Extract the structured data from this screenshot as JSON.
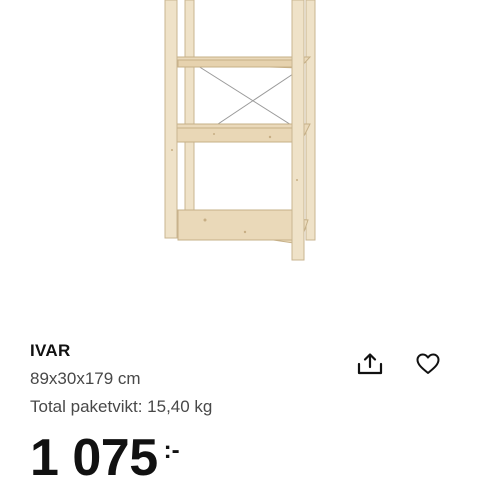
{
  "product": {
    "name": "IVAR",
    "dimensions": "89x30x179 cm",
    "package_weight": "Total paketvikt: 15,40 kg",
    "image_alt": "IVAR shelving unit, untreated pine"
  },
  "price": {
    "amount": "1 075",
    "suffix": ":-"
  },
  "actions": {
    "share_icon": "share-icon",
    "favorite_icon": "heart-icon"
  },
  "colors": {
    "text": "#111111",
    "secondary_text": "#484848",
    "wood": "#ecdcc0",
    "wood_edge": "#c8b48e"
  }
}
